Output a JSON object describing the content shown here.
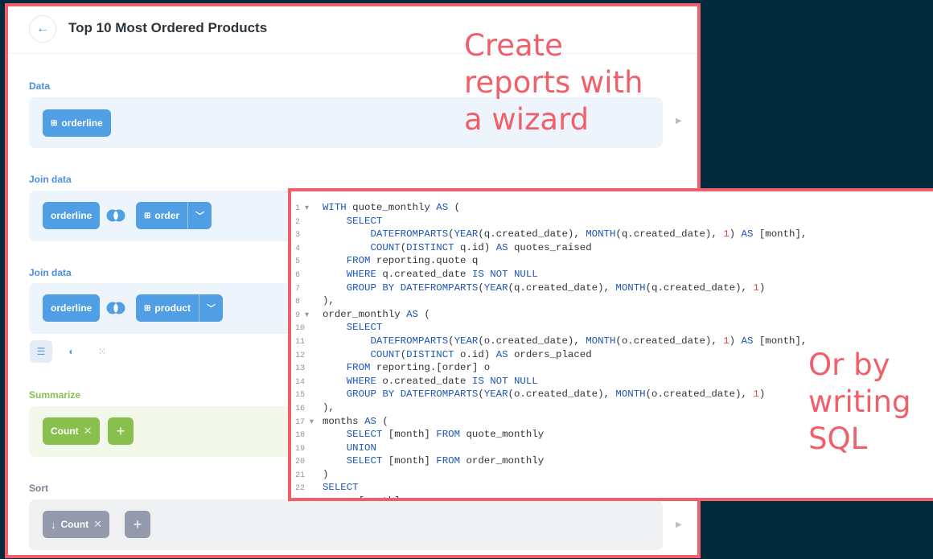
{
  "header": {
    "title": "Top 10 Most Ordered Products",
    "back_icon": "arrow-left-icon"
  },
  "data_section": {
    "label": "Data",
    "table": "orderline"
  },
  "joins": [
    {
      "label": "Join data",
      "left": "orderline",
      "right": "order"
    },
    {
      "label": "Join data",
      "left": "orderline",
      "right": "product"
    }
  ],
  "summarize": {
    "label": "Summarize",
    "metric": "Count"
  },
  "sort": {
    "label": "Sort",
    "field": "Count",
    "arrow": "↓"
  },
  "captions": {
    "wizard": [
      "Create",
      "reports with",
      "a wizard"
    ],
    "sql": [
      "Or by",
      "writing",
      "SQL"
    ]
  },
  "colors": {
    "background": "#042a3e",
    "highlight_border": "#f0606a",
    "accent_blue": "#509ee3",
    "accent_green": "#88bf4d",
    "accent_gray": "#949aab"
  },
  "sql_lines": [
    "WITH quote_monthly AS (",
    "    SELECT",
    "        DATEFROMPARTS(YEAR(q.created_date), MONTH(q.created_date), 1) AS [month],",
    "        COUNT(DISTINCT q.id) AS quotes_raised",
    "    FROM reporting.quote q",
    "    WHERE q.created_date IS NOT NULL",
    "    GROUP BY DATEFROMPARTS(YEAR(q.created_date), MONTH(q.created_date), 1)",
    "),",
    "order_monthly AS (",
    "    SELECT",
    "        DATEFROMPARTS(YEAR(o.created_date), MONTH(o.created_date), 1) AS [month],",
    "        COUNT(DISTINCT o.id) AS orders_placed",
    "    FROM reporting.[order] o",
    "    WHERE o.created_date IS NOT NULL",
    "    GROUP BY DATEFROMPARTS(YEAR(o.created_date), MONTH(o.created_date), 1)",
    "),",
    "months AS (",
    "    SELECT [month] FROM quote_monthly",
    "    UNION",
    "    SELECT [month] FROM order_monthly",
    ")",
    "SELECT",
    "    m.[month]"
  ],
  "fold_lines": [
    1,
    9,
    17
  ]
}
